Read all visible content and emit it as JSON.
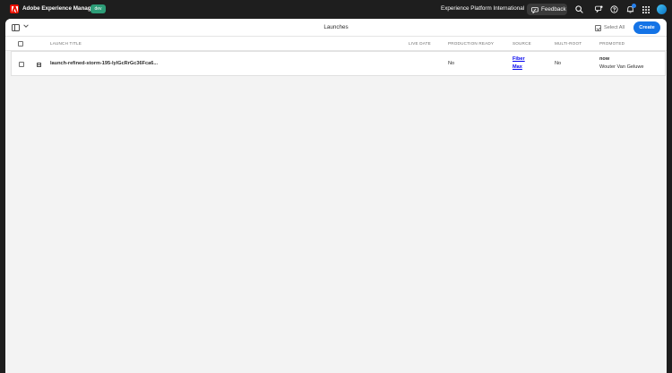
{
  "shell": {
    "app_title": "Adobe Experience Manager",
    "env_badge": "dev",
    "org_name": "Experience Platform International",
    "feedback_label": "Feedback",
    "brand_color": "#eb1000",
    "env_color": "#2d9d78",
    "icons": [
      "search-icon",
      "whats-new-icon",
      "help-icon",
      "notifications-icon",
      "app-switcher-icon"
    ]
  },
  "toolbar": {
    "title": "Launches",
    "select_all_label": "Select All",
    "create_label": "Create",
    "accent_color": "#1473e6"
  },
  "table": {
    "columns": {
      "title": "LAUNCH TITLE",
      "live_date": "LIVE DATE",
      "production_ready": "PRODUCTION READY",
      "source": "SOURCE",
      "multi_root": "MULTI-ROOT",
      "promoted": "PROMOTED"
    },
    "rows": [
      {
        "title": "launch-refined-storm-195-lylGcRrGc36Fca6...",
        "live_date": "",
        "production_ready": "No",
        "source_line1": "Fiber",
        "source_line2": "Max",
        "multi_root": "No",
        "promoted_when": "now",
        "promoted_by": "Wouter Van Geluwe"
      }
    ]
  }
}
